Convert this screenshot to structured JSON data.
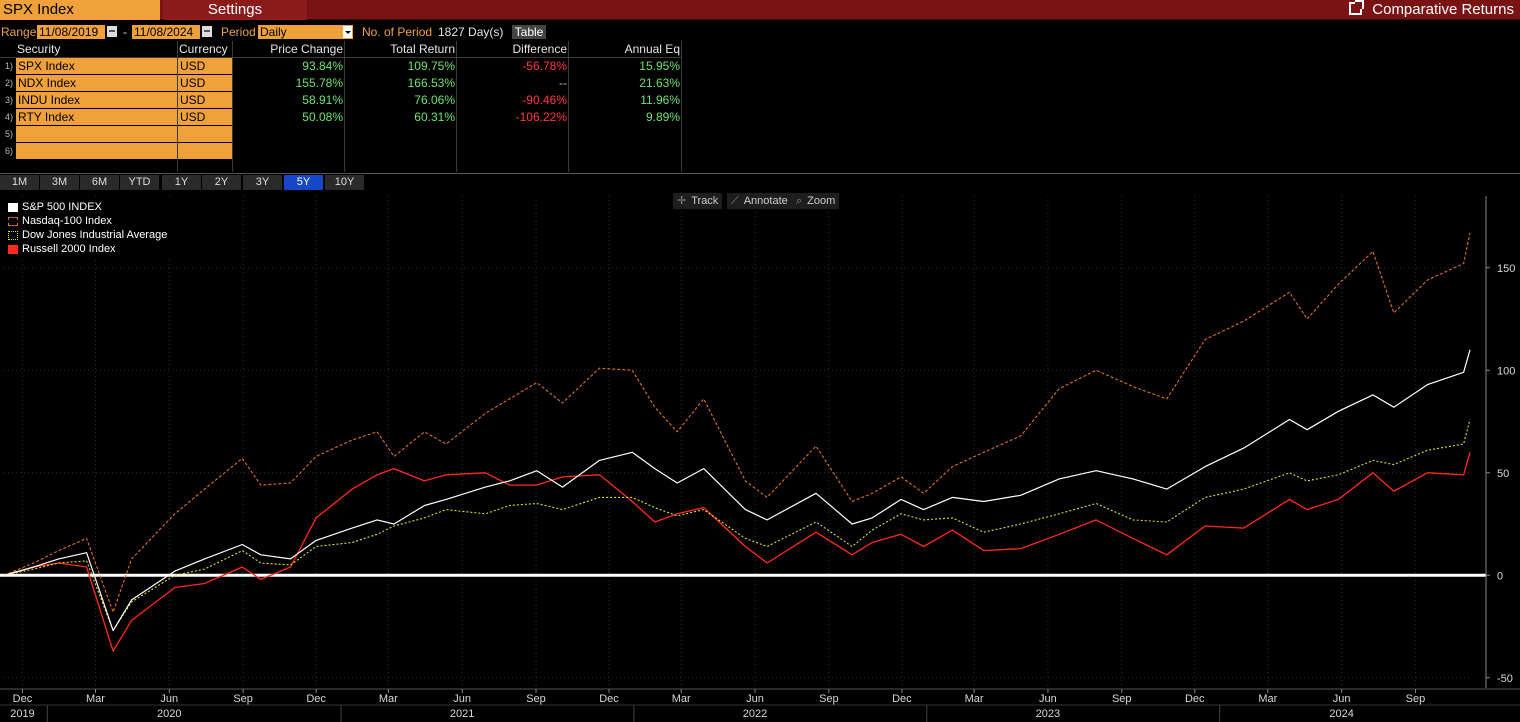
{
  "topbar": {
    "security": "SPX Index",
    "settings_label": "Settings",
    "title": "Comparative Returns",
    "title_icon": "external-link-icon"
  },
  "params": {
    "range_label": "Range",
    "start_date": "11/08/2019",
    "dash": "-",
    "end_date": "11/08/2024",
    "period_label": "Period",
    "period_value": "Daily",
    "num_period_label": "No. of Period",
    "num_period_value": "1827 Day(s)",
    "table_button": "Table"
  },
  "table": {
    "headers": [
      "Security",
      "Currency",
      "Price Change",
      "Total Return",
      "Difference",
      "Annual Eq"
    ],
    "rows": [
      {
        "num": "1)",
        "security": "SPX Index",
        "currency": "USD",
        "price_change": "93.84%",
        "total_return": "109.75%",
        "difference": "-56.78%",
        "annual_eq": "15.95%"
      },
      {
        "num": "2)",
        "security": "NDX Index",
        "currency": "USD",
        "price_change": "155.78%",
        "total_return": "166.53%",
        "difference": "--",
        "annual_eq": "21.63%"
      },
      {
        "num": "3)",
        "security": "INDU Index",
        "currency": "USD",
        "price_change": "58.91%",
        "total_return": "76.06%",
        "difference": "-90.46%",
        "annual_eq": "11.96%"
      },
      {
        "num": "4)",
        "security": "RTY Index",
        "currency": "USD",
        "price_change": "50.08%",
        "total_return": "60.31%",
        "difference": "-106.22%",
        "annual_eq": "9.89%"
      },
      {
        "num": "5)",
        "security": "",
        "currency": "",
        "price_change": "",
        "total_return": "",
        "difference": "",
        "annual_eq": ""
      },
      {
        "num": "6)",
        "security": "",
        "currency": "",
        "price_change": "",
        "total_return": "",
        "difference": "",
        "annual_eq": ""
      }
    ]
  },
  "periods": {
    "buttons": [
      "1M",
      "3M",
      "6M",
      "YTD",
      "1Y",
      "2Y",
      "3Y",
      "5Y",
      "10Y"
    ],
    "active": "5Y"
  },
  "toolbar": {
    "track": "Track",
    "annotate": "Annotate",
    "zoom": "Zoom"
  },
  "colors": {
    "orange": "#f0a13c",
    "brand_bar": "#7a1414",
    "active_period": "#1747c9",
    "positive": "#6ee36e",
    "negative": "#ff3b3b",
    "spx": "#ffffff",
    "ndx": "#e0701e",
    "indu": "#e0e02a",
    "rty": "#ff2a1a"
  },
  "chart_data": {
    "type": "line",
    "title": "",
    "xlabel": "",
    "ylabel": "",
    "ylim": [
      -55,
      185
    ],
    "y_ticks": [
      -50,
      0,
      50,
      100,
      150
    ],
    "x_ticks": [
      {
        "label": "Dec",
        "year": "2019",
        "date": "2019-12-01"
      },
      {
        "label": "Mar",
        "date": "2020-03-01"
      },
      {
        "label": "Jun",
        "year": "2020",
        "date": "2020-06-01"
      },
      {
        "label": "Sep",
        "date": "2020-09-01"
      },
      {
        "label": "Dec",
        "date": "2020-12-01"
      },
      {
        "label": "Mar",
        "date": "2021-03-01"
      },
      {
        "label": "Jun",
        "year": "2021",
        "date": "2021-06-01"
      },
      {
        "label": "Sep",
        "date": "2021-09-01"
      },
      {
        "label": "Dec",
        "date": "2021-12-01"
      },
      {
        "label": "Mar",
        "date": "2022-03-01"
      },
      {
        "label": "Jun",
        "year": "2022",
        "date": "2022-06-01"
      },
      {
        "label": "Sep",
        "date": "2022-09-01"
      },
      {
        "label": "Dec",
        "date": "2022-12-01"
      },
      {
        "label": "Mar",
        "date": "2023-03-01"
      },
      {
        "label": "Jun",
        "year": "2023",
        "date": "2023-06-01"
      },
      {
        "label": "Sep",
        "date": "2023-09-01"
      },
      {
        "label": "Dec",
        "date": "2023-12-01"
      },
      {
        "label": "Mar",
        "date": "2024-03-01"
      },
      {
        "label": "Jun",
        "year": "2024",
        "date": "2024-06-01"
      },
      {
        "label": "Sep",
        "date": "2024-09-01"
      }
    ],
    "x": [
      "2019-11-08",
      "2019-12-15",
      "2020-01-15",
      "2020-02-19",
      "2020-03-23",
      "2020-04-15",
      "2020-06-08",
      "2020-07-15",
      "2020-08-31",
      "2020-09-23",
      "2020-10-30",
      "2020-12-01",
      "2021-01-15",
      "2021-02-15",
      "2021-03-08",
      "2021-04-15",
      "2021-05-12",
      "2021-06-30",
      "2021-07-30",
      "2021-09-02",
      "2021-10-04",
      "2021-11-19",
      "2021-12-30",
      "2022-01-27",
      "2022-02-24",
      "2022-03-29",
      "2022-05-20",
      "2022-06-16",
      "2022-08-16",
      "2022-09-30",
      "2022-10-25",
      "2022-11-30",
      "2022-12-28",
      "2023-02-02",
      "2023-03-13",
      "2023-04-28",
      "2023-06-15",
      "2023-07-31",
      "2023-09-15",
      "2023-10-27",
      "2023-12-14",
      "2024-01-31",
      "2024-03-28",
      "2024-04-19",
      "2024-05-28",
      "2024-07-10",
      "2024-08-05",
      "2024-09-16",
      "2024-10-31",
      "2024-11-08"
    ],
    "series": [
      {
        "name": "S&P 500 INDEX",
        "style": "solid",
        "values": [
          0,
          4,
          8,
          11,
          -27,
          -12,
          2,
          8,
          15,
          10,
          8,
          17,
          23,
          27,
          25,
          34,
          37,
          43,
          46,
          51,
          43,
          56,
          60,
          52,
          45,
          52,
          32,
          27,
          40,
          25,
          28,
          37,
          32,
          38,
          36,
          39,
          47,
          51,
          47,
          42,
          53,
          62,
          76,
          71,
          80,
          88,
          82,
          93,
          99,
          110
        ]
      },
      {
        "name": "Nasdaq-100 Index",
        "style": "dashed",
        "values": [
          0,
          6,
          12,
          18,
          -18,
          8,
          30,
          42,
          57,
          44,
          45,
          58,
          66,
          70,
          58,
          70,
          64,
          79,
          86,
          94,
          84,
          101,
          100,
          82,
          70,
          86,
          46,
          38,
          63,
          36,
          40,
          48,
          40,
          53,
          60,
          68,
          91,
          100,
          92,
          86,
          115,
          124,
          138,
          125,
          142,
          158,
          128,
          144,
          152,
          167
        ]
      },
      {
        "name": "Dow Jones Industrial Average",
        "style": "dotted",
        "values": [
          0,
          3,
          6,
          7,
          -27,
          -13,
          0,
          3,
          12,
          6,
          5,
          14,
          16,
          20,
          24,
          28,
          32,
          30,
          34,
          35,
          32,
          38,
          38,
          33,
          29,
          32,
          18,
          14,
          26,
          14,
          22,
          30,
          27,
          28,
          21,
          25,
          30,
          35,
          27,
          26,
          38,
          42,
          50,
          46,
          49,
          56,
          54,
          61,
          64,
          76
        ]
      },
      {
        "name": "Russell 2000 Index",
        "style": "solid",
        "values": [
          0,
          4,
          6,
          4,
          -37,
          -22,
          -6,
          -4,
          4,
          -2,
          4,
          28,
          42,
          49,
          52,
          46,
          49,
          50,
          44,
          44,
          48,
          49,
          36,
          26,
          30,
          33,
          14,
          6,
          21,
          10,
          16,
          20,
          14,
          22,
          12,
          13,
          20,
          27,
          18,
          10,
          24,
          23,
          37,
          32,
          37,
          50,
          41,
          50,
          49,
          60
        ]
      }
    ],
    "legend": "top-left",
    "grid": true
  }
}
